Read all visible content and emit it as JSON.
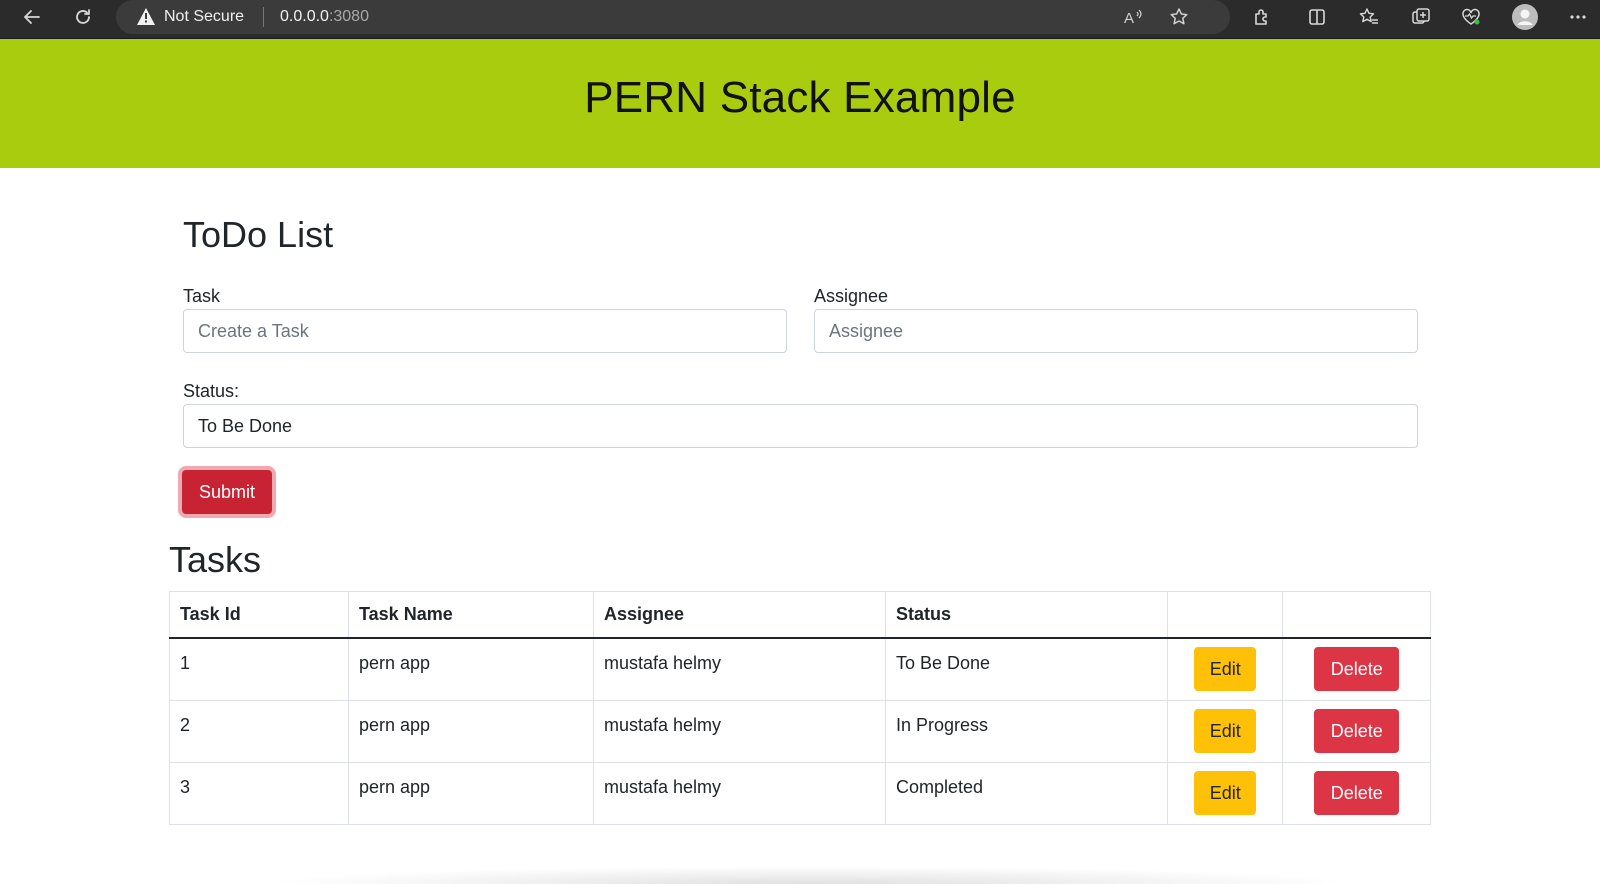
{
  "browser": {
    "security_label": "Not Secure",
    "url_host": "0.0.0.0",
    "url_port": ":3080",
    "icons": [
      "back-icon",
      "reload-icon",
      "warning-icon",
      "read-aloud-icon",
      "favorite-star-icon",
      "extensions-icon",
      "split-screen-icon",
      "favorites-icon",
      "collections-icon",
      "health-icon",
      "profile-avatar-icon",
      "more-icon"
    ]
  },
  "header": {
    "title": "PERN Stack Example",
    "background_color": "#aacc0f"
  },
  "form": {
    "heading": "ToDo List",
    "task_label": "Task",
    "task_placeholder": "Create a Task",
    "task_value": "",
    "assignee_label": "Assignee",
    "assignee_placeholder": "Assignee",
    "assignee_value": "",
    "status_label": "Status:",
    "status_selected": "To Be Done",
    "submit_label": "Submit"
  },
  "tasks": {
    "heading": "Tasks",
    "columns": [
      "Task Id",
      "Task Name",
      "Assignee",
      "Status"
    ],
    "rows": [
      {
        "id": "1",
        "name": "pern app",
        "assignee": "mustafa helmy",
        "status": "To Be Done"
      },
      {
        "id": "2",
        "name": "pern app",
        "assignee": "mustafa helmy",
        "status": "In Progress"
      },
      {
        "id": "3",
        "name": "pern app",
        "assignee": "mustafa helmy",
        "status": "Completed"
      }
    ],
    "edit_label": "Edit",
    "delete_label": "Delete"
  },
  "colors": {
    "submit": "#c82333",
    "edit": "#ffc107",
    "delete": "#dc3545"
  }
}
